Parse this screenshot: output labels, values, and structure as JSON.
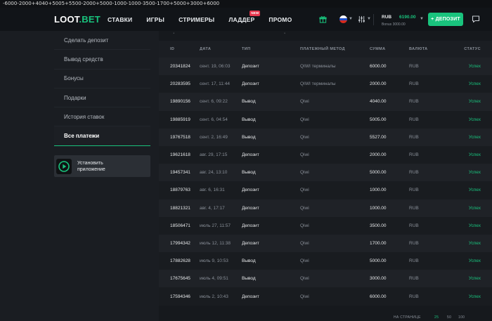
{
  "topline": "-6000-2000+4040+5005+5500-2000+5000-1000-1000-3500-1700+5000+3000+6000",
  "header": {
    "logo": "LOOT",
    "logo_suffix": ".BET",
    "nav": [
      {
        "label": "СТАВКИ"
      },
      {
        "label": "ИГРЫ"
      },
      {
        "label": "СТРИМЕРЫ"
      },
      {
        "label": "ЛАДДЕР",
        "badge": "NEW"
      },
      {
        "label": "ПРОМО"
      }
    ],
    "balance": {
      "currency": "RUB",
      "amount": "6190.00",
      "bonus": "Bonus 3000.00"
    },
    "deposit_label": "+ ДЕПОЗИТ",
    "accent": "#19c37d"
  },
  "sidebar": {
    "items": [
      {
        "label": "Сделать депозит"
      },
      {
        "label": "Вывод средств"
      },
      {
        "label": "Бонусы"
      },
      {
        "label": "Подарки"
      },
      {
        "label": "История ставок"
      },
      {
        "label": "Все платежи",
        "active": true
      }
    ],
    "app_line1": "Установить",
    "app_line2": "приложение"
  },
  "table": {
    "headers": [
      "ID",
      "ДАТА",
      "ТИП",
      "ПЛАТЕЖНЫЙ МЕТОД",
      "СУММА",
      "ВАЛЮТА",
      "СТАТУС"
    ],
    "rows": [
      [
        "20341824",
        "сент. 19, 06:03",
        "Депозит",
        "QIWI терминалы",
        "6000.00",
        "RUB",
        "Успех"
      ],
      [
        "20283595",
        "сент. 17, 11:44",
        "Депозит",
        "QIWI терминалы",
        "2000.00",
        "RUB",
        "Успех"
      ],
      [
        "19890156",
        "сент. 6, 09:22",
        "Вывод",
        "Qiwi",
        "4040.00",
        "RUB",
        "Успех"
      ],
      [
        "19885919",
        "сент. 6, 04:54",
        "Вывод",
        "Qiwi",
        "5005.00",
        "RUB",
        "Успех"
      ],
      [
        "19767518",
        "сент. 2, 16:49",
        "Вывод",
        "Qiwi",
        "5527.00",
        "RUB",
        "Успех"
      ],
      [
        "19621618",
        "авг. 29, 17:15",
        "Депозит",
        "Qiwi",
        "2000.00",
        "RUB",
        "Успех"
      ],
      [
        "19457341",
        "авг. 24, 13:10",
        "Вывод",
        "Qiwi",
        "5000.00",
        "RUB",
        "Успех"
      ],
      [
        "18879763",
        "авг. 6, 16:31",
        "Депозит",
        "Qiwi",
        "1000.00",
        "RUB",
        "Успех"
      ],
      [
        "18821321",
        "авг. 4, 17:17",
        "Депозит",
        "Qiwi",
        "1000.00",
        "RUB",
        "Успех"
      ],
      [
        "18506471",
        "июль 27, 11:57",
        "Депозит",
        "Qiwi",
        "3500.00",
        "RUB",
        "Успех"
      ],
      [
        "17994342",
        "июль 12, 11:38",
        "Депозит",
        "Qiwi",
        "1700.00",
        "RUB",
        "Успех"
      ],
      [
        "17882628",
        "июль 9, 10:53",
        "Вывод",
        "Qiwi",
        "5000.00",
        "RUB",
        "Успех"
      ],
      [
        "17675645",
        "июль 4, 09:51",
        "Вывод",
        "Qiwi",
        "3000.00",
        "RUB",
        "Успех"
      ],
      [
        "17594346",
        "июль 2, 10:43",
        "Депозит",
        "Qiwi",
        "6000.00",
        "RUB",
        "Успех"
      ]
    ]
  },
  "pager": {
    "label": "НА СТРАНИЦЕ",
    "options": [
      "25",
      "50",
      "100"
    ],
    "selected": "25"
  }
}
